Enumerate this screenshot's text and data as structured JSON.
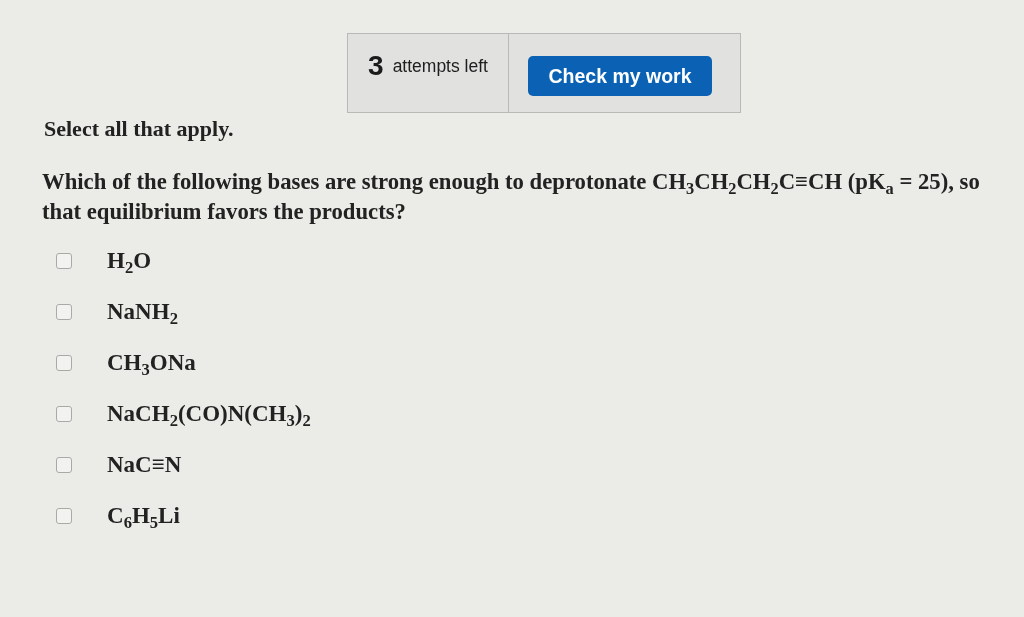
{
  "attempts": {
    "count": "3",
    "label": "attempts left"
  },
  "check_button": {
    "label": "Check my work"
  },
  "instruction": "Select all that apply.",
  "question": "Which of the following bases are strong enough to deprotonate CH$_{3}$CH$_{2}$CH$_{2}$C≡CH (pK$_{a}$ = 25), so that equilibrium favors the products?",
  "options": [
    {
      "label": "H$_{2}$O",
      "checked": false
    },
    {
      "label": "NaNH$_{2}$",
      "checked": false
    },
    {
      "label": "CH$_{3}$ONa",
      "checked": false
    },
    {
      "label": "NaCH$_{2}$(CO)N(CH$_{3}$)$_{2}$",
      "checked": false
    },
    {
      "label": "NaC≡N",
      "checked": false
    },
    {
      "label": "C$_{6}$H$_{5}$Li",
      "checked": false
    }
  ]
}
